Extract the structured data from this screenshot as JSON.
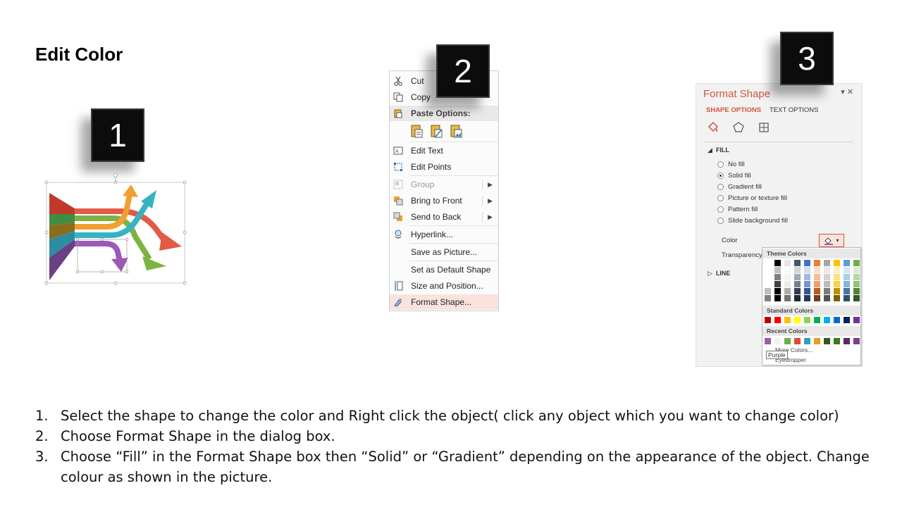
{
  "slide": {
    "title": "Edit Color"
  },
  "badges": [
    "1",
    "2",
    "3"
  ],
  "context_menu": {
    "items": [
      {
        "label": "Cut",
        "icon": "scissors-icon"
      },
      {
        "label": "Copy",
        "icon": "copy-icon"
      },
      {
        "label": "Paste Options:",
        "icon": "paste-icon"
      },
      {
        "label": "Edit Text",
        "icon": "edit-text-icon"
      },
      {
        "label": "Edit Points",
        "icon": "edit-points-icon"
      },
      {
        "label": "Group",
        "icon": "group-icon"
      },
      {
        "label": "Bring to Front",
        "icon": "bring-front-icon"
      },
      {
        "label": "Send to Back",
        "icon": "send-back-icon"
      },
      {
        "label": "Hyperlink...",
        "icon": "hyperlink-icon"
      },
      {
        "label": "Save as Picture...",
        "icon": ""
      },
      {
        "label": "Set as Default Shape",
        "icon": ""
      },
      {
        "label": "Size and Position...",
        "icon": "size-position-icon"
      },
      {
        "label": "Format Shape...",
        "icon": "format-shape-icon"
      }
    ]
  },
  "format_pane": {
    "title": "Format Shape",
    "tabs": [
      "SHAPE OPTIONS",
      "TEXT OPTIONS"
    ],
    "fill_section": "FILL",
    "fill_options": [
      "No fill",
      "Solid fill",
      "Gradient fill",
      "Picture or texture fill",
      "Pattern fill",
      "Slide background fill"
    ],
    "selected_fill": "Solid fill",
    "color_label": "Color",
    "transparency_label": "Transparency",
    "line_section": "LINE",
    "accent": "#d2553c"
  },
  "palette": {
    "theme_label": "Theme Colors",
    "standard_label": "Standard Colors",
    "recent_label": "Recent Colors",
    "more_label": "More Colors...",
    "eyedropper_label": "Eyedropper",
    "tooltip": "Purple",
    "theme_top": [
      "#ffffff",
      "#000000",
      "#e7e6e6",
      "#44546a",
      "#4472c4",
      "#ed7d31",
      "#a5a5a5",
      "#ffc000",
      "#5b9bd5",
      "#70ad47"
    ],
    "standard": [
      "#c00000",
      "#ff0000",
      "#ffc000",
      "#ffff00",
      "#92d050",
      "#00b050",
      "#00b0f0",
      "#0070c0",
      "#002060",
      "#7030a0"
    ],
    "recent": [
      "#9b5ba5",
      "#f2f2f2",
      "#70ad47",
      "#e04a3a",
      "#2ea3b5",
      "#e8a020",
      "#375623",
      "#3a7a1e",
      "#5a2a6a",
      "#7b3f8a"
    ]
  },
  "instructions": [
    "Select the shape to change the color and Right click the object( click any object which you want to change color)",
    "Choose Format Shape in the dialog box.",
    "Choose “Fill” in the Format Shape box then “Solid” or “Gradient” depending on the appearance of the object. Change colour as shown in the picture."
  ],
  "instruction_numbers": [
    "1.",
    "2.",
    "3."
  ]
}
